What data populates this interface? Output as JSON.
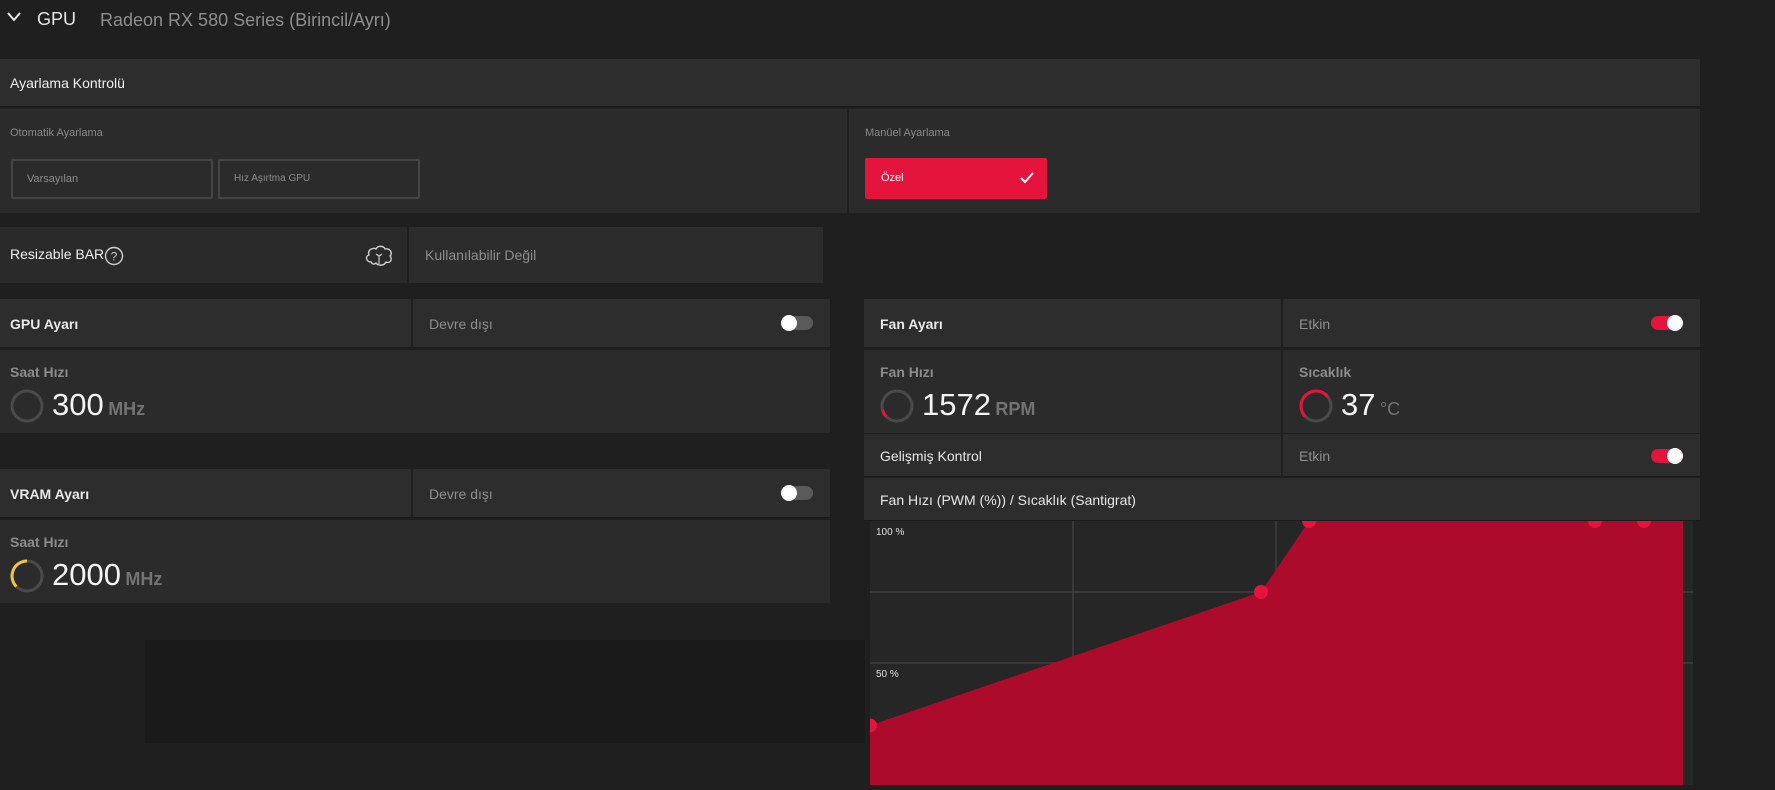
{
  "header": {
    "section": "GPU",
    "device": "Radeon RX 580 Series (Birincil/Ayrı)"
  },
  "tuning_control": {
    "title": "Ayarlama Kontrolü",
    "auto_label": "Otomatik Ayarlama",
    "auto_options": [
      "Varsayılan",
      "Hız Aşırtma GPU"
    ],
    "manual_label": "Manüel Ayarlama",
    "manual_selected": "Özel"
  },
  "resizable_bar": {
    "label": "Resizable BAR",
    "status": "Kullanılabilir Değil"
  },
  "gpu_tuning": {
    "title": "GPU Ayarı",
    "state": "Devre dışı",
    "enabled": false,
    "clock_label": "Saat Hızı",
    "clock_value": "300",
    "clock_unit": "MHz"
  },
  "vram_tuning": {
    "title": "VRAM Ayarı",
    "state": "Devre dışı",
    "enabled": false,
    "clock_label": "Saat Hızı",
    "clock_value": "2000",
    "clock_unit": "MHz"
  },
  "fan_tuning": {
    "title": "Fan Ayarı",
    "state": "Etkin",
    "enabled": true,
    "speed_label": "Fan Hızı",
    "speed_value": "1572",
    "speed_unit": "RPM",
    "temp_label": "Sıcaklık",
    "temp_value": "37",
    "temp_unit": "°C"
  },
  "advanced_control": {
    "label": "Gelişmiş Kontrol",
    "state": "Etkin",
    "enabled": true
  },
  "fan_curve": {
    "title": "Fan Hızı (PWM (%)) / Sıcaklık (Santigrat)",
    "y_ticks": [
      "100 %",
      "50 %"
    ]
  },
  "colors": {
    "accent": "#e4143c",
    "curve_fill": "#ad0b2c",
    "gauge_yellow": "#f0c63a"
  },
  "chart_data": {
    "type": "area",
    "title": "Fan Hızı (PWM (%)) / Sıcaklık (Santigrat)",
    "xlabel": "",
    "ylabel": "",
    "ylim": [
      0,
      100
    ],
    "y_tick_labels": [
      "100 %",
      "50 %"
    ],
    "points_pct": [
      28,
      75,
      100,
      100,
      100
    ],
    "grid": true
  }
}
